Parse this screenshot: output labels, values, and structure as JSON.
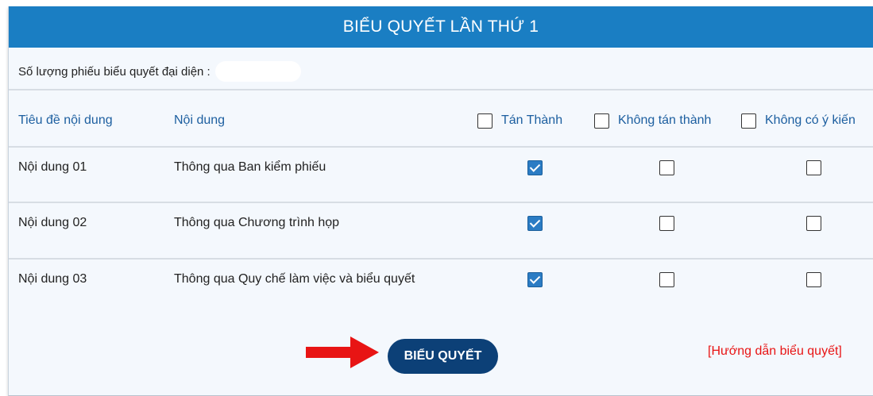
{
  "header": {
    "title": "BIỂU QUYẾT LẦN THỨ 1"
  },
  "representative": {
    "label": "Số lượng phiếu biểu quyết đại diện :",
    "value": ""
  },
  "columns": {
    "title": "Tiêu đề nội dung",
    "content": "Nội dung",
    "approve": "Tán Thành",
    "disapprove": "Không tán thành",
    "no_opinion": "Không có ý kiến"
  },
  "header_checks": {
    "approve": false,
    "disapprove": false,
    "no_opinion": false
  },
  "rows": [
    {
      "title": "Nội dung 01",
      "content": "Thông qua Ban kiểm phiếu",
      "approve": true,
      "disapprove": false,
      "no_opinion": false
    },
    {
      "title": "Nội dung 02",
      "content": "Thông qua Chương trình họp",
      "approve": true,
      "disapprove": false,
      "no_opinion": false
    },
    {
      "title": "Nội dung 03",
      "content": "Thông qua Quy chế làm việc và biểu quyết",
      "approve": true,
      "disapprove": false,
      "no_opinion": false
    }
  ],
  "actions": {
    "vote_button": "BIỂU QUYẾT",
    "guide_link": "[Hướng dẫn biểu quyết]"
  },
  "colors": {
    "header_bg": "#1a7ec3",
    "button_bg": "#0c4077",
    "arrow": "#e81414",
    "link": "#e81414",
    "checked": "#2b7cc4"
  }
}
